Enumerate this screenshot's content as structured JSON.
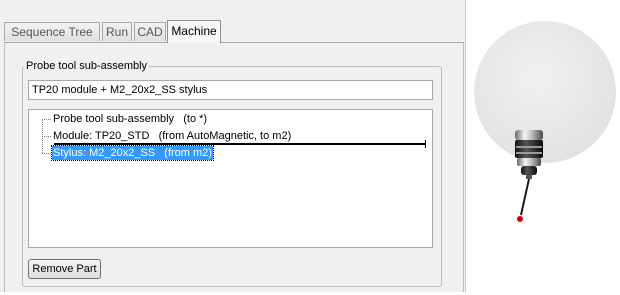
{
  "tabs": [
    {
      "label": "Sequence Tree",
      "active": false
    },
    {
      "label": "Run",
      "active": false
    },
    {
      "label": "CAD",
      "active": false
    },
    {
      "label": "Machine",
      "active": true
    }
  ],
  "probe_group": {
    "title": "Probe tool sub-assembly",
    "assembly_name": "TP20 module + M2_20x2_SS stylus",
    "tree_items": [
      {
        "label": "Probe tool sub-assembly   (to *)",
        "selected": false
      },
      {
        "label": "Module: TP20_STD   (from AutoMagnetic, to m2)",
        "selected": false
      },
      {
        "label": "Stylus: M2_20x2_SS   (from m2)",
        "selected": true
      }
    ],
    "remove_button": "Remove Part"
  },
  "preview": {
    "icon": "probe-3d-preview",
    "colors": {
      "sphere": "#e6e6e6",
      "stylus_tip": "#d40000"
    }
  }
}
